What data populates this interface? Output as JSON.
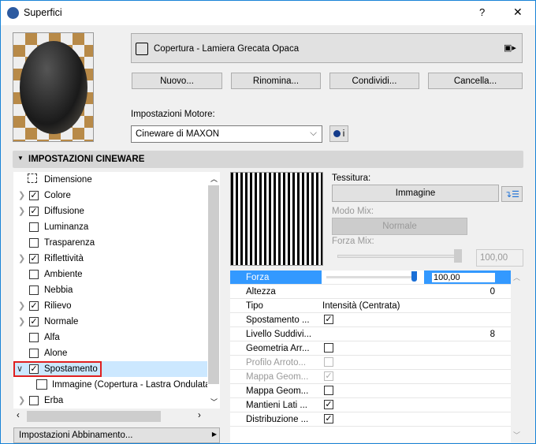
{
  "window": {
    "title": "Superfici",
    "help": "?",
    "close": "✕"
  },
  "material": {
    "name": "Copertura - Lamiera Grecata Opaca"
  },
  "buttons": {
    "new": "Nuovo...",
    "rename": "Rinomina...",
    "share": "Condividi...",
    "delete": "Cancella..."
  },
  "engine": {
    "label": "Impostazioni Motore:",
    "value": "Cineware di MAXON",
    "info": "i"
  },
  "section": {
    "title": "IMPOSTAZIONI CINEWARE"
  },
  "tree": [
    {
      "label": "Dimensione",
      "type": "size"
    },
    {
      "label": "Colore",
      "checked": true,
      "expandable": true
    },
    {
      "label": "Diffusione",
      "checked": true,
      "expandable": true
    },
    {
      "label": "Luminanza",
      "checked": false
    },
    {
      "label": "Trasparenza",
      "checked": false
    },
    {
      "label": "Riflettività",
      "checked": true,
      "expandable": true
    },
    {
      "label": "Ambiente",
      "checked": false
    },
    {
      "label": "Nebbia",
      "checked": false
    },
    {
      "label": "Rilievo",
      "checked": true,
      "expandable": true
    },
    {
      "label": "Normale",
      "checked": true,
      "expandable": true
    },
    {
      "label": "Alfa",
      "checked": false
    },
    {
      "label": "Alone",
      "checked": false
    },
    {
      "label": "Spostamento",
      "checked": true,
      "expanded": true,
      "selected": true
    },
    {
      "label": "Immagine (Copertura - Lastra Ondulata",
      "type": "child"
    },
    {
      "label": "Erba",
      "checked": false,
      "expandable": true
    }
  ],
  "matching_button": "Impostazioni Abbinamento...",
  "texture": {
    "label": "Tessitura:",
    "value": "Immagine",
    "mix_mode_label": "Modo Mix:",
    "mix_mode": "Normale",
    "mix_strength_label": "Forza Mix:",
    "mix_strength": "100,00",
    "mix_strength_fraction": 1.0
  },
  "properties": [
    {
      "label": "Forza",
      "value": "100,00",
      "slider_fraction": 1.0,
      "selected": true
    },
    {
      "label": "Altezza",
      "number": "0"
    },
    {
      "label": "Tipo",
      "value": "Intensità (Centrata)"
    },
    {
      "label": "Spostamento ...",
      "checked": true
    },
    {
      "label": "Livello Suddivi...",
      "number": "8"
    },
    {
      "label": "Geometria Arr...",
      "checked": false
    },
    {
      "label": "Profilo Arroto...",
      "checked": false,
      "disabled": true
    },
    {
      "label": "Mappa Geom...",
      "checked": true,
      "disabled": true
    },
    {
      "label": "Mappa Geom...",
      "checked": false
    },
    {
      "label": "Mantieni Lati ...",
      "checked": true
    },
    {
      "label": "Distribuzione ...",
      "checked": true
    }
  ],
  "colors": {
    "accent": "#3399ff",
    "highlight_border": "#e02020",
    "selection": "#cce8ff"
  }
}
